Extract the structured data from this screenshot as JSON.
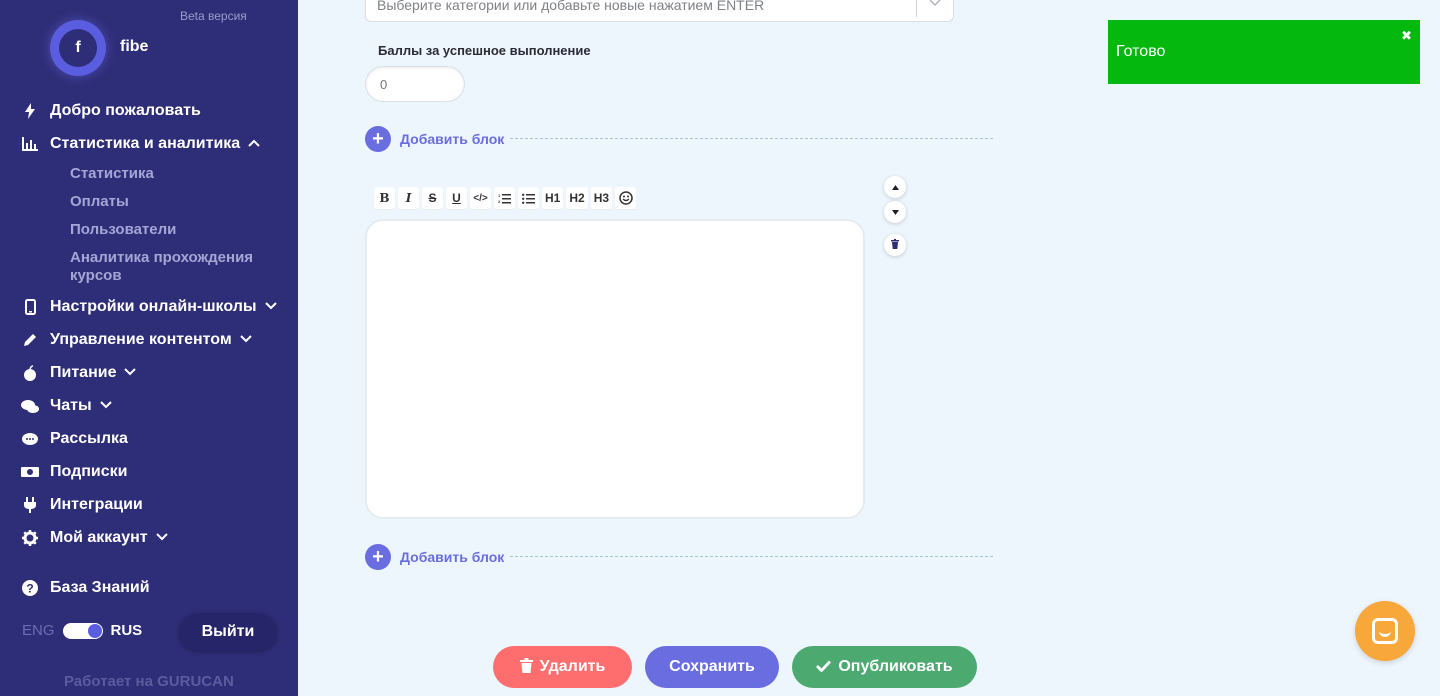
{
  "sidebar": {
    "beta": "Beta версия",
    "avatar_letter": "f",
    "username": "fibe",
    "items": [
      {
        "label": "Добро пожаловать",
        "icon": "bolt-icon"
      },
      {
        "label": "Статистика и аналитика",
        "icon": "chart-icon"
      },
      {
        "label": "Настройки онлайн-школы",
        "icon": "mobile-icon"
      },
      {
        "label": "Управление контентом",
        "icon": "pencil-icon"
      },
      {
        "label": "Питание",
        "icon": "apple-icon"
      },
      {
        "label": "Чаты",
        "icon": "chats-icon"
      },
      {
        "label": "Рассылка",
        "icon": "comment-icon"
      },
      {
        "label": "Подписки",
        "icon": "money-icon"
      },
      {
        "label": "Интеграции",
        "icon": "plug-icon"
      },
      {
        "label": "Мой аккаунт",
        "icon": "gear-icon"
      },
      {
        "label": "База Знаний",
        "icon": "question-icon"
      }
    ],
    "subitems": [
      "Статистика",
      "Оплаты",
      "Пользователи",
      "Аналитика прохождения курсов"
    ],
    "lang_eng": "ENG",
    "lang_rus": "RUS",
    "logout": "Выйти",
    "powered": "Работает на GURUCAN"
  },
  "main": {
    "category_placeholder": "Выберите категории или добавьте новые нажатием ENTER",
    "points_label": "Баллы за успешное выполнение",
    "points_placeholder": "0",
    "add_block": "Добавить блок",
    "toolbar": [
      "B",
      "I",
      "S",
      "U",
      "</>",
      "ol",
      "ul",
      "H1",
      "H2",
      "H3",
      "☺"
    ],
    "buttons": {
      "delete": "Удалить",
      "save": "Сохранить",
      "publish": "Опубликовать"
    }
  },
  "toast": {
    "message": "Готово"
  },
  "colors": {
    "sidebar": "#2e2d77",
    "accent": "#6a6de0",
    "danger": "#ff6e6e",
    "success": "#4caa70",
    "toast": "#05b80d",
    "chat": "#f8a73b"
  }
}
